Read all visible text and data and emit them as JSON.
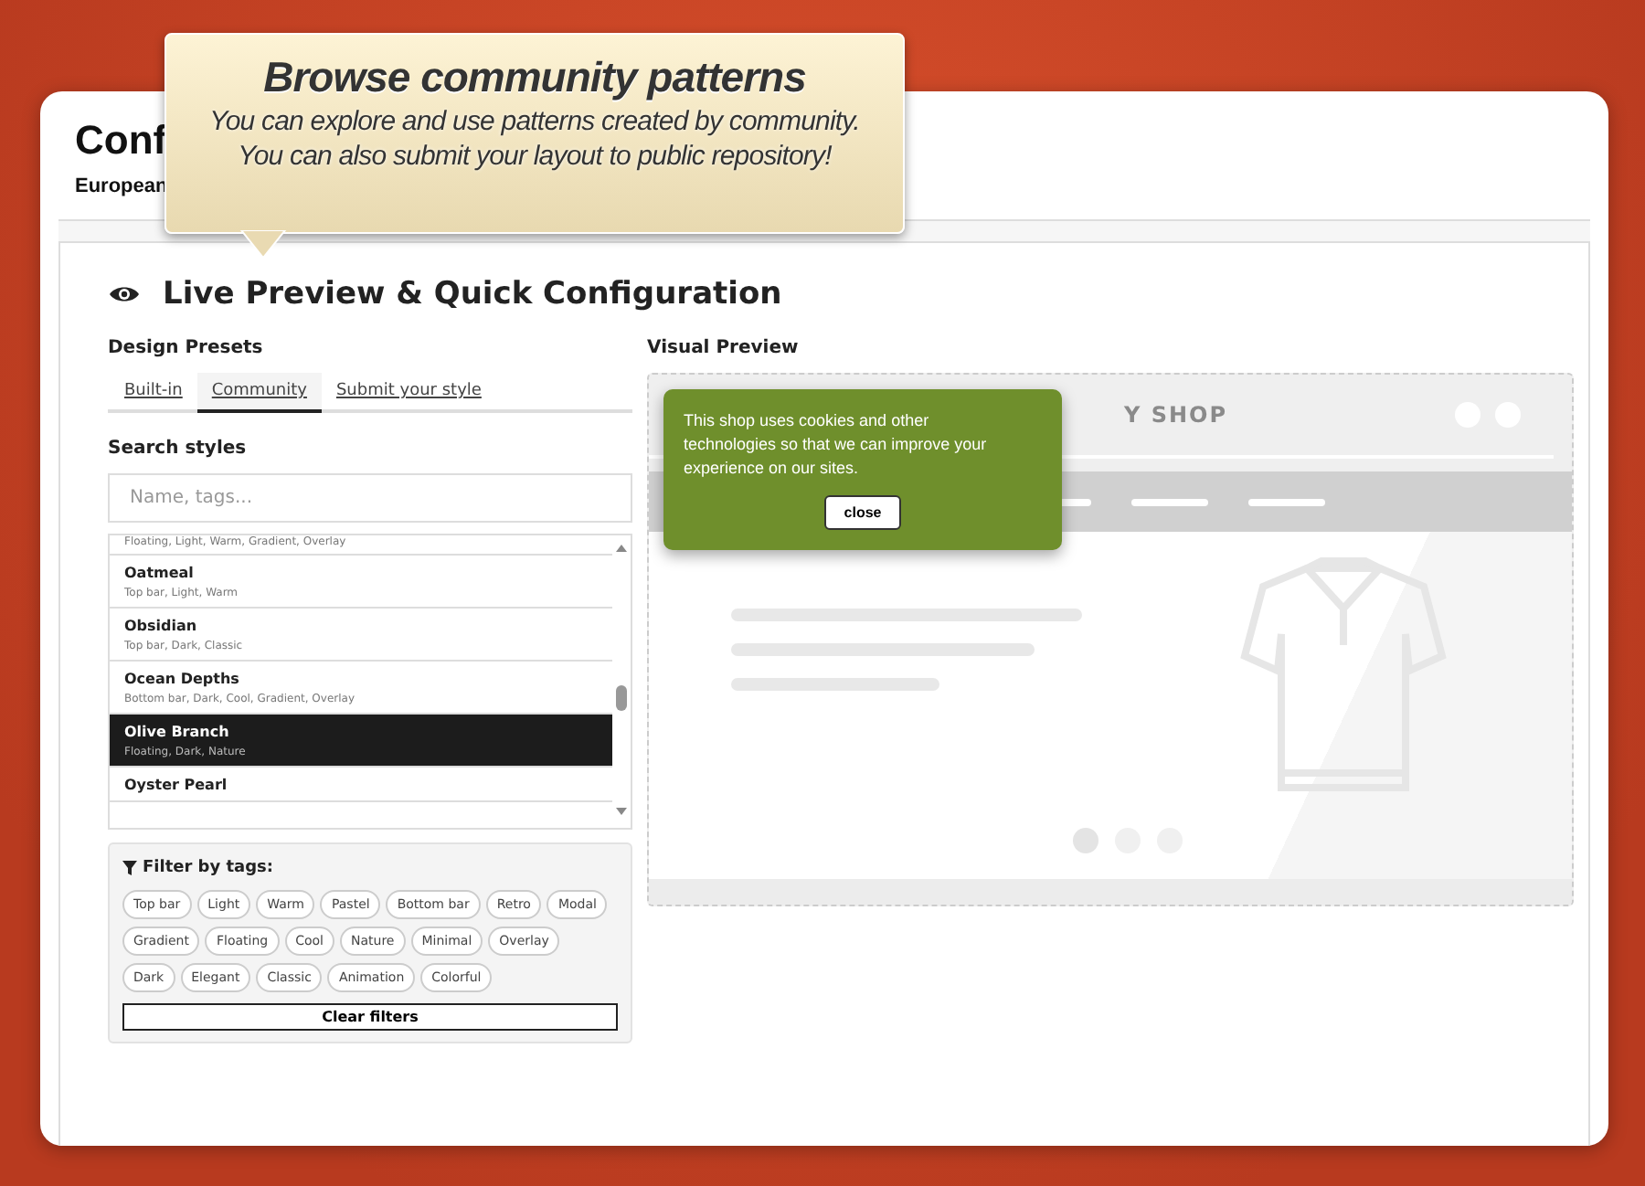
{
  "page": {
    "title": "Conf",
    "subtitle": "European"
  },
  "tooltip": {
    "title": "Browse community patterns",
    "lines": [
      "You can explore and use patterns created by community.",
      "You can also submit your layout to public repository!"
    ]
  },
  "section": {
    "title": "Live Preview & Quick Configuration"
  },
  "presets": {
    "heading": "Design Presets",
    "tabs": [
      {
        "label": "Built-in",
        "selected": false
      },
      {
        "label": "Community",
        "selected": true
      },
      {
        "label": "Submit your style",
        "selected": false
      }
    ],
    "search": {
      "label": "Search styles",
      "placeholder": "Name, tags..."
    },
    "styles": [
      {
        "tags": "Floating, Light, Warm, Gradient, Overlay",
        "selected": false
      },
      {
        "name": "Oatmeal",
        "tags": "Top bar, Light, Warm",
        "selected": false
      },
      {
        "name": "Obsidian",
        "tags": "Top bar, Dark, Classic",
        "selected": false
      },
      {
        "name": "Ocean Depths",
        "tags": "Bottom bar, Dark, Cool, Gradient, Overlay",
        "selected": false
      },
      {
        "name": "Olive Branch",
        "tags": "Floating, Dark, Nature",
        "selected": true
      },
      {
        "name": "Oyster Pearl",
        "selected": false
      }
    ],
    "filter": {
      "title": "Filter by tags:",
      "tags": [
        "Top bar",
        "Light",
        "Warm",
        "Pastel",
        "Bottom bar",
        "Retro",
        "Modal",
        "Gradient",
        "Floating",
        "Cool",
        "Nature",
        "Minimal",
        "Overlay",
        "Dark",
        "Elegant",
        "Classic",
        "Animation",
        "Colorful"
      ],
      "clear": "Clear filters"
    }
  },
  "preview": {
    "heading": "Visual Preview",
    "shop_name": "Y SHOP",
    "cookie": {
      "text": "This shop uses cookies and other technologies so that we can improve your experience on our sites.",
      "button": "close",
      "color": "#6f8f2c"
    }
  }
}
